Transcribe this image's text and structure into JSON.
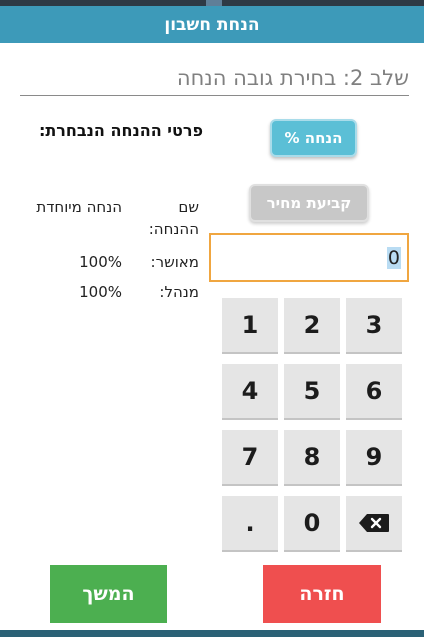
{
  "header": {
    "title": "הנחת חשבון"
  },
  "step": {
    "text": "שלב 2: בחירת גובה הנחה"
  },
  "discount_types": {
    "percent_label": "% הנחה",
    "price_label": "קביעת מחיר"
  },
  "amount": {
    "value": "0"
  },
  "keypad": {
    "k1": "1",
    "k2": "2",
    "k3": "3",
    "k4": "4",
    "k5": "5",
    "k6": "6",
    "k7": "7",
    "k8": "8",
    "k9": "9",
    "dot": ".",
    "k0": "0",
    "backspace_icon": "backspace-icon"
  },
  "details": {
    "title": "פרטי ההנחה הנבחרת:",
    "name_label": "שם ההנחה:",
    "name_value": "הנחה מיוחדת",
    "approved_label": "מאושר:",
    "approved_value": "100%",
    "manager_label": "מנהל:",
    "manager_value": "100%"
  },
  "footer": {
    "continue_label": "המשך",
    "back_label": "חזרה"
  },
  "colors": {
    "header": "#3d9ab9",
    "percent_button": "#5bbfd6",
    "price_button": "#c8c8c8",
    "input_border": "#f0a640",
    "continue": "#4caf50",
    "back": "#ef4f4f"
  }
}
